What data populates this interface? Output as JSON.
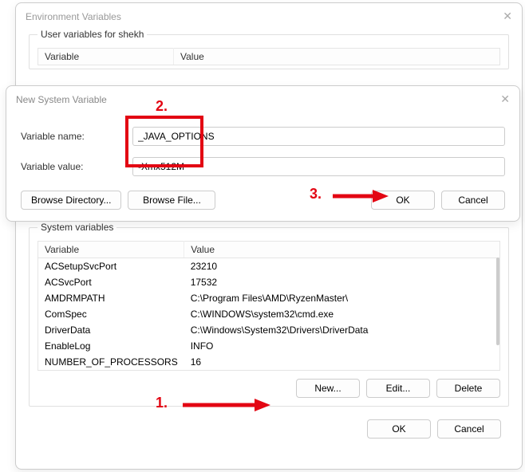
{
  "env_dialog": {
    "title": "Environment Variables",
    "user_group_label": "User variables for shekh",
    "columns": {
      "var": "Variable",
      "val": "Value"
    },
    "sys_group_label": "System variables",
    "sys_rows": [
      {
        "var": "ACSetupSvcPort",
        "val": "23210"
      },
      {
        "var": "ACSvcPort",
        "val": "17532"
      },
      {
        "var": "AMDRMPATH",
        "val": "C:\\Program Files\\AMD\\RyzenMaster\\"
      },
      {
        "var": "ComSpec",
        "val": "C:\\WINDOWS\\system32\\cmd.exe"
      },
      {
        "var": "DriverData",
        "val": "C:\\Windows\\System32\\Drivers\\DriverData"
      },
      {
        "var": "EnableLog",
        "val": "INFO"
      },
      {
        "var": "NUMBER_OF_PROCESSORS",
        "val": "16"
      }
    ],
    "buttons": {
      "new": "New...",
      "edit": "Edit...",
      "delete": "Delete",
      "ok": "OK",
      "cancel": "Cancel"
    }
  },
  "new_dialog": {
    "title": "New System Variable",
    "name_label": "Variable name:",
    "value_label": "Variable value:",
    "name_value": "_JAVA_OPTIONS",
    "value_value": "-Xmx512M",
    "buttons": {
      "browse_dir": "Browse Directory...",
      "browse_file": "Browse File...",
      "ok": "OK",
      "cancel": "Cancel"
    }
  },
  "annotations": {
    "n1": "1.",
    "n2": "2.",
    "n3": "3."
  }
}
